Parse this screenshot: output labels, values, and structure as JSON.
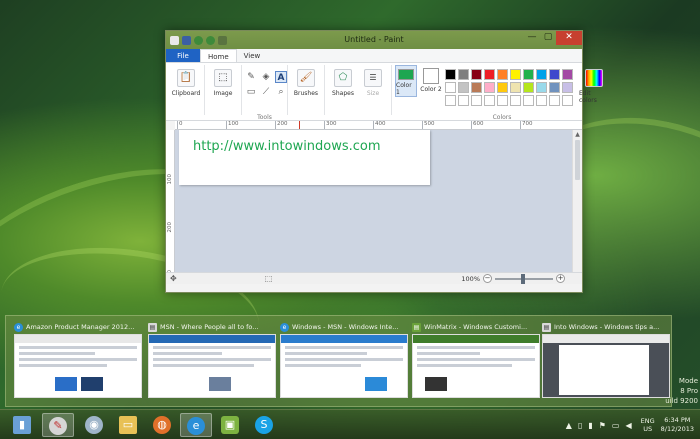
{
  "paint": {
    "title": "Untitled - Paint",
    "window_buttons": {
      "minimize": "—",
      "maximize": "▢",
      "close": "✕"
    },
    "tabs": {
      "file": "File",
      "home": "Home",
      "view": "View"
    },
    "ribbon": {
      "clipboard": "Clipboard",
      "image": "Image",
      "tools_group": "Tools",
      "brushes": "Brushes",
      "shapes": "Shapes",
      "size": "Size",
      "color1": "Color 1",
      "color2": "Color 2",
      "colors_group": "Colors",
      "edit_colors": "Edit colors"
    },
    "ruler_h": [
      "0",
      "100",
      "200",
      "300",
      "400",
      "500",
      "600",
      "700"
    ],
    "ruler_v": [
      "100",
      "200",
      "300"
    ],
    "canvas_text": "http://www.intowindows.com",
    "zoom_level": "100%",
    "color1_value": "#1ea651",
    "color2_value": "#ffffff",
    "palette": [
      "#000000",
      "#7f7f7f",
      "#880015",
      "#ed1c24",
      "#ff7f27",
      "#fff200",
      "#22b14c",
      "#00a2e8",
      "#3f48cc",
      "#a349a4",
      "#ffffff",
      "#c3c3c3",
      "#b97a57",
      "#ffaec9",
      "#ffc90e",
      "#efe4b0",
      "#b5e61d",
      "#99d9ea",
      "#7092be",
      "#c8bfe7",
      "#ffffff",
      "#ffffff",
      "#ffffff",
      "#ffffff",
      "#ffffff",
      "#ffffff",
      "#ffffff",
      "#ffffff",
      "#ffffff",
      "#ffffff"
    ]
  },
  "thumbnails": [
    {
      "title": "Amazon Product Manager 2012..."
    },
    {
      "title": "MSN - Where People all to fo..."
    },
    {
      "title": "Windows - MSN - Windows Inte..."
    },
    {
      "title": "WinMatrix - Windows Customi..."
    },
    {
      "title": "Into Windows - Windows tips a..."
    }
  ],
  "desktop_watermark": {
    "line1": "Mode",
    "line2": "8 Pro",
    "line3": "uild 9200"
  },
  "taskbar": {
    "tray": {
      "lang_top": "ENG",
      "lang_bottom": "US",
      "time": "6:34 PM",
      "date": "8/12/2013"
    }
  }
}
